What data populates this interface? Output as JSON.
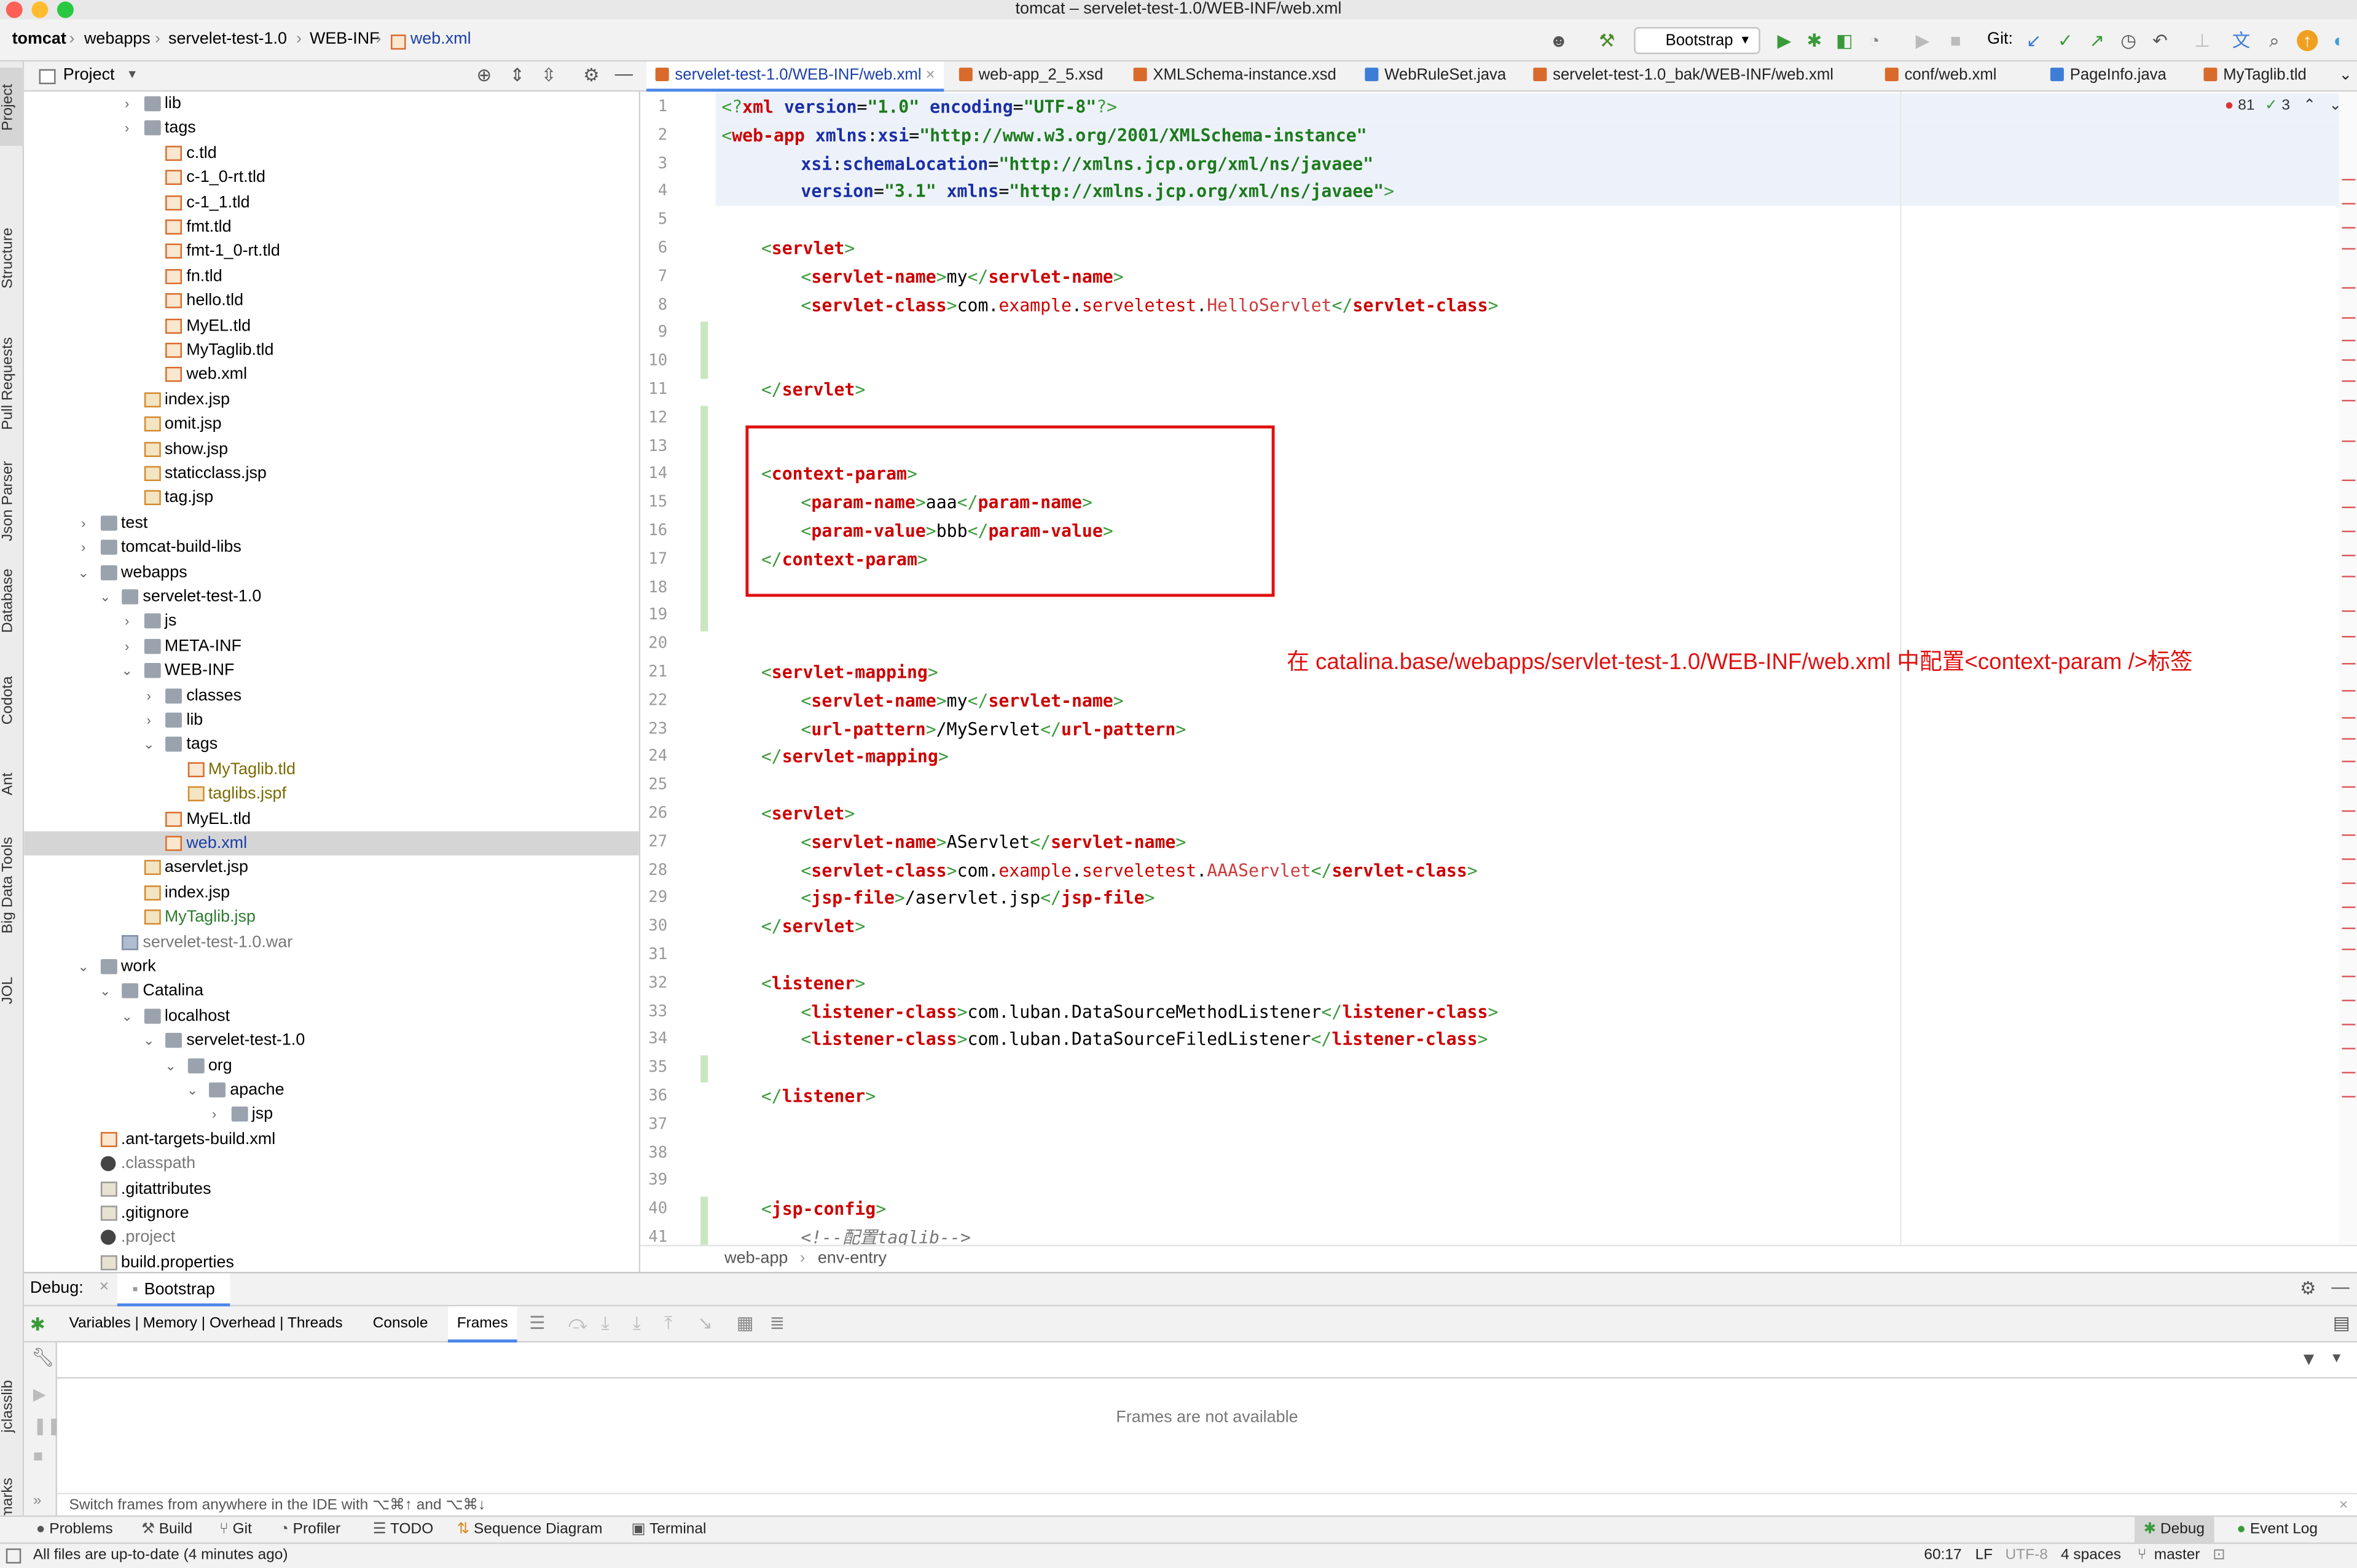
{
  "window_title": "tomcat – servelet-test-1.0/WEB-INF/web.xml",
  "navbar": {
    "crumbs": [
      "tomcat",
      "webapps",
      "servelet-test-1.0",
      "WEB-INF",
      "web.xml"
    ],
    "run_config": "Bootstrap",
    "git_label": "Git:"
  },
  "left_stripe": [
    "Project",
    "Structure",
    "Pull Requests",
    "Json Parser",
    "Database",
    "Codota",
    "Ant",
    "Big Data Tools",
    "JOL",
    "jclasslib",
    "Bookmarks"
  ],
  "project_panel": {
    "title": "Project",
    "tree": [
      {
        "label": "lib",
        "depth": 3,
        "arrow": "right",
        "icon": "folder"
      },
      {
        "label": "tags",
        "depth": 3,
        "arrow": "right",
        "icon": "folder"
      },
      {
        "label": "c.tld",
        "depth": 4,
        "arrow": "",
        "icon": "xml"
      },
      {
        "label": "c-1_0-rt.tld",
        "depth": 4,
        "arrow": "",
        "icon": "xml"
      },
      {
        "label": "c-1_1.tld",
        "depth": 4,
        "arrow": "",
        "icon": "xml"
      },
      {
        "label": "fmt.tld",
        "depth": 4,
        "arrow": "",
        "icon": "xml"
      },
      {
        "label": "fmt-1_0-rt.tld",
        "depth": 4,
        "arrow": "",
        "icon": "xml"
      },
      {
        "label": "fn.tld",
        "depth": 4,
        "arrow": "",
        "icon": "xml"
      },
      {
        "label": "hello.tld",
        "depth": 4,
        "arrow": "",
        "icon": "xml"
      },
      {
        "label": "MyEL.tld",
        "depth": 4,
        "arrow": "",
        "icon": "xml"
      },
      {
        "label": "MyTaglib.tld",
        "depth": 4,
        "arrow": "",
        "icon": "xml"
      },
      {
        "label": "web.xml",
        "depth": 4,
        "arrow": "",
        "icon": "xml"
      },
      {
        "label": "index.jsp",
        "depth": 3,
        "arrow": "",
        "icon": "jsp"
      },
      {
        "label": "omit.jsp",
        "depth": 3,
        "arrow": "",
        "icon": "jsp"
      },
      {
        "label": "show.jsp",
        "depth": 3,
        "arrow": "",
        "icon": "jsp"
      },
      {
        "label": "staticclass.jsp",
        "depth": 3,
        "arrow": "",
        "icon": "jsp"
      },
      {
        "label": "tag.jsp",
        "depth": 3,
        "arrow": "",
        "icon": "jsp"
      },
      {
        "label": "test",
        "depth": 1,
        "arrow": "right",
        "icon": "folder"
      },
      {
        "label": "tomcat-build-libs",
        "depth": 1,
        "arrow": "right",
        "icon": "folder"
      },
      {
        "label": "webapps",
        "depth": 1,
        "arrow": "down",
        "icon": "folder"
      },
      {
        "label": "servelet-test-1.0",
        "depth": 2,
        "arrow": "down",
        "icon": "folder"
      },
      {
        "label": "js",
        "depth": 3,
        "arrow": "right",
        "icon": "folder"
      },
      {
        "label": "META-INF",
        "depth": 3,
        "arrow": "right",
        "icon": "folder"
      },
      {
        "label": "WEB-INF",
        "depth": 3,
        "arrow": "down",
        "icon": "folder"
      },
      {
        "label": "classes",
        "depth": 4,
        "arrow": "right",
        "icon": "folder"
      },
      {
        "label": "lib",
        "depth": 4,
        "arrow": "right",
        "icon": "folder"
      },
      {
        "label": "tags",
        "depth": 4,
        "arrow": "down",
        "icon": "folder"
      },
      {
        "label": "MyTaglib.tld",
        "depth": 5,
        "arrow": "",
        "icon": "xml",
        "color": "#7a6a00"
      },
      {
        "label": "taglibs.jspf",
        "depth": 5,
        "arrow": "",
        "icon": "jsp",
        "color": "#7a6a00"
      },
      {
        "label": "MyEL.tld",
        "depth": 4,
        "arrow": "",
        "icon": "xml"
      },
      {
        "label": "web.xml",
        "depth": 4,
        "arrow": "",
        "icon": "xml",
        "selected": true,
        "color": "#1a3fa8"
      },
      {
        "label": "aservlet.jsp",
        "depth": 3,
        "arrow": "",
        "icon": "jsp"
      },
      {
        "label": "index.jsp",
        "depth": 3,
        "arrow": "",
        "icon": "jsp"
      },
      {
        "label": "MyTaglib.jsp",
        "depth": 3,
        "arrow": "",
        "icon": "jsp",
        "color": "#2f7a2f"
      },
      {
        "label": "servelet-test-1.0.war",
        "depth": 2,
        "arrow": "",
        "icon": "war",
        "color": "#777"
      },
      {
        "label": "work",
        "depth": 1,
        "arrow": "down",
        "icon": "folder"
      },
      {
        "label": "Catalina",
        "depth": 2,
        "arrow": "down",
        "icon": "folder"
      },
      {
        "label": "localhost",
        "depth": 3,
        "arrow": "down",
        "icon": "folder"
      },
      {
        "label": "servelet-test-1.0",
        "depth": 4,
        "arrow": "down",
        "icon": "folder"
      },
      {
        "label": "org",
        "depth": 5,
        "arrow": "down",
        "icon": "folder"
      },
      {
        "label": "apache",
        "depth": 6,
        "arrow": "down",
        "icon": "folder"
      },
      {
        "label": "jsp",
        "depth": 7,
        "arrow": "right",
        "icon": "folder"
      },
      {
        "label": ".ant-targets-build.xml",
        "depth": 1,
        "arrow": "",
        "icon": "xml"
      },
      {
        "label": ".classpath",
        "depth": 1,
        "arrow": "",
        "icon": "dot",
        "color": "#777"
      },
      {
        "label": ".gitattributes",
        "depth": 1,
        "arrow": "",
        "icon": "prop"
      },
      {
        "label": ".gitignore",
        "depth": 1,
        "arrow": "",
        "icon": "prop"
      },
      {
        "label": ".project",
        "depth": 1,
        "arrow": "",
        "icon": "dot",
        "color": "#777"
      },
      {
        "label": "build.properties",
        "depth": 1,
        "arrow": "",
        "icon": "prop"
      }
    ]
  },
  "editor_tabs": [
    {
      "label": "servelet-test-1.0/WEB-INF/web.xml",
      "active": true,
      "icon": "#d86a2b"
    },
    {
      "label": "web-app_2_5.xsd",
      "active": false,
      "icon": "#d86a2b"
    },
    {
      "label": "XMLSchema-instance.xsd",
      "active": false,
      "icon": "#d86a2b"
    },
    {
      "label": "WebRuleSet.java",
      "active": false,
      "icon": "#3d7dd8"
    },
    {
      "label": "servelet-test-1.0_bak/WEB-INF/web.xml",
      "active": false,
      "icon": "#d86a2b"
    },
    {
      "label": "conf/web.xml",
      "active": false,
      "icon": "#d86a2b"
    },
    {
      "label": "PageInfo.java",
      "active": false,
      "icon": "#3d7dd8"
    },
    {
      "label": "MyTaglib.tld",
      "active": false,
      "icon": "#d86a2b"
    }
  ],
  "inspection": {
    "errors": "81",
    "checks": "3"
  },
  "code_lines": [
    {
      "n": "1",
      "hl": true,
      "ind": 0,
      "t": [
        [
          "br",
          "<?"
        ],
        [
          "tg",
          "xml "
        ],
        [
          "at",
          "version"
        ],
        [
          "tx",
          "="
        ],
        [
          "vl",
          "\"1.0\" "
        ],
        [
          "at",
          "encoding"
        ],
        [
          "tx",
          "="
        ],
        [
          "vl",
          "\"UTF-8\""
        ],
        [
          "br",
          "?>"
        ]
      ]
    },
    {
      "n": "2",
      "hl": true,
      "ind": 0,
      "t": [
        [
          "br",
          "<"
        ],
        [
          "tg",
          "web-app "
        ],
        [
          "at",
          "xmlns"
        ],
        [
          "tx",
          ":"
        ],
        [
          "at",
          "xsi"
        ],
        [
          "tx",
          "="
        ],
        [
          "vl",
          "\"http://www.w3.org/2001/XMLSchema-instance\""
        ]
      ]
    },
    {
      "n": "3",
      "hl": true,
      "ind": 8,
      "t": [
        [
          "at",
          "xsi"
        ],
        [
          "tx",
          ":"
        ],
        [
          "at",
          "schemaLocation"
        ],
        [
          "tx",
          "="
        ],
        [
          "vl",
          "\"http://xmlns.jcp.org/xml/ns/javaee\""
        ]
      ]
    },
    {
      "n": "4",
      "hl": true,
      "ind": 8,
      "t": [
        [
          "at",
          "version"
        ],
        [
          "tx",
          "="
        ],
        [
          "vl",
          "\"3.1\" "
        ],
        [
          "at",
          "xmlns"
        ],
        [
          "tx",
          "="
        ],
        [
          "vl",
          "\"http://xmlns.jcp.org/xml/ns/javaee\""
        ],
        [
          "br",
          ">"
        ]
      ]
    },
    {
      "n": "5",
      "ind": 0,
      "t": []
    },
    {
      "n": "6",
      "ind": 4,
      "t": [
        [
          "br",
          "<"
        ],
        [
          "tg",
          "servlet"
        ],
        [
          "br",
          ">"
        ]
      ]
    },
    {
      "n": "7",
      "ind": 8,
      "t": [
        [
          "br",
          "<"
        ],
        [
          "tg",
          "servlet-name"
        ],
        [
          "br",
          ">"
        ],
        [
          "tx",
          "my"
        ],
        [
          "br",
          "</"
        ],
        [
          "tg",
          "servlet-name"
        ],
        [
          "br",
          ">"
        ]
      ]
    },
    {
      "n": "8",
      "ind": 8,
      "t": [
        [
          "br",
          "<"
        ],
        [
          "tg",
          "servlet-class"
        ],
        [
          "br",
          ">"
        ],
        [
          "tx",
          "com."
        ],
        [
          "pk",
          "example"
        ],
        [
          "tx",
          "."
        ],
        [
          "pk",
          "serveletest"
        ],
        [
          "tx",
          "."
        ],
        [
          "cs",
          "HelloServlet"
        ],
        [
          "br",
          "</"
        ],
        [
          "tg",
          "servlet-class"
        ],
        [
          "br",
          ">"
        ]
      ]
    },
    {
      "n": "9",
      "ind": 0,
      "t": []
    },
    {
      "n": "10",
      "ind": 0,
      "t": []
    },
    {
      "n": "11",
      "ind": 4,
      "t": [
        [
          "br",
          "</"
        ],
        [
          "tg",
          "servlet"
        ],
        [
          "br",
          ">"
        ]
      ]
    },
    {
      "n": "12",
      "ind": 0,
      "t": []
    },
    {
      "n": "13",
      "ind": 0,
      "t": []
    },
    {
      "n": "14",
      "ind": 4,
      "t": [
        [
          "br",
          "<"
        ],
        [
          "tg",
          "context-param"
        ],
        [
          "br",
          ">"
        ]
      ]
    },
    {
      "n": "15",
      "ind": 8,
      "t": [
        [
          "br",
          "<"
        ],
        [
          "tg",
          "param-name"
        ],
        [
          "br",
          ">"
        ],
        [
          "tx",
          "aaa"
        ],
        [
          "br",
          "</"
        ],
        [
          "tg",
          "param-name"
        ],
        [
          "br",
          ">"
        ]
      ]
    },
    {
      "n": "16",
      "ind": 8,
      "t": [
        [
          "br",
          "<"
        ],
        [
          "tg",
          "param-value"
        ],
        [
          "br",
          ">"
        ],
        [
          "tx",
          "bbb"
        ],
        [
          "br",
          "</"
        ],
        [
          "tg",
          "param-value"
        ],
        [
          "br",
          ">"
        ]
      ]
    },
    {
      "n": "17",
      "ind": 4,
      "t": [
        [
          "br",
          "</"
        ],
        [
          "tg",
          "context-param"
        ],
        [
          "br",
          ">"
        ]
      ]
    },
    {
      "n": "18",
      "ind": 0,
      "t": []
    },
    {
      "n": "19",
      "ind": 0,
      "t": []
    },
    {
      "n": "20",
      "ind": 0,
      "t": []
    },
    {
      "n": "21",
      "ind": 4,
      "t": [
        [
          "br",
          "<"
        ],
        [
          "tg",
          "servlet-mapping"
        ],
        [
          "br",
          ">"
        ]
      ]
    },
    {
      "n": "22",
      "ind": 8,
      "t": [
        [
          "br",
          "<"
        ],
        [
          "tg",
          "servlet-name"
        ],
        [
          "br",
          ">"
        ],
        [
          "tx",
          "my"
        ],
        [
          "br",
          "</"
        ],
        [
          "tg",
          "servlet-name"
        ],
        [
          "br",
          ">"
        ]
      ]
    },
    {
      "n": "23",
      "ind": 8,
      "t": [
        [
          "br",
          "<"
        ],
        [
          "tg",
          "url-pattern"
        ],
        [
          "br",
          ">"
        ],
        [
          "tx",
          "/MyServlet"
        ],
        [
          "br",
          "</"
        ],
        [
          "tg",
          "url-pattern"
        ],
        [
          "br",
          ">"
        ]
      ]
    },
    {
      "n": "24",
      "ind": 4,
      "t": [
        [
          "br",
          "</"
        ],
        [
          "tg",
          "servlet-mapping"
        ],
        [
          "br",
          ">"
        ]
      ]
    },
    {
      "n": "25",
      "ind": 0,
      "t": []
    },
    {
      "n": "26",
      "ind": 4,
      "t": [
        [
          "br",
          "<"
        ],
        [
          "tg",
          "servlet"
        ],
        [
          "br",
          ">"
        ]
      ]
    },
    {
      "n": "27",
      "ind": 8,
      "t": [
        [
          "br",
          "<"
        ],
        [
          "tg",
          "servlet-name"
        ],
        [
          "br",
          ">"
        ],
        [
          "tx",
          "AServlet"
        ],
        [
          "br",
          "</"
        ],
        [
          "tg",
          "servlet-name"
        ],
        [
          "br",
          ">"
        ]
      ]
    },
    {
      "n": "28",
      "ind": 8,
      "t": [
        [
          "br",
          "<"
        ],
        [
          "tg",
          "servlet-class"
        ],
        [
          "br",
          ">"
        ],
        [
          "tx",
          "com."
        ],
        [
          "pk",
          "example"
        ],
        [
          "tx",
          "."
        ],
        [
          "pk",
          "serveletest"
        ],
        [
          "tx",
          "."
        ],
        [
          "cs",
          "AAAServlet"
        ],
        [
          "br",
          "</"
        ],
        [
          "tg",
          "servlet-class"
        ],
        [
          "br",
          ">"
        ]
      ]
    },
    {
      "n": "29",
      "ind": 8,
      "t": [
        [
          "br",
          "<"
        ],
        [
          "tg",
          "jsp-file"
        ],
        [
          "br",
          ">"
        ],
        [
          "tx",
          "/aservlet.jsp"
        ],
        [
          "br",
          "</"
        ],
        [
          "tg",
          "jsp-file"
        ],
        [
          "br",
          ">"
        ]
      ]
    },
    {
      "n": "30",
      "ind": 4,
      "t": [
        [
          "br",
          "</"
        ],
        [
          "tg",
          "servlet"
        ],
        [
          "br",
          ">"
        ]
      ]
    },
    {
      "n": "31",
      "ind": 0,
      "t": []
    },
    {
      "n": "32",
      "ind": 4,
      "t": [
        [
          "br",
          "<"
        ],
        [
          "tg",
          "listener"
        ],
        [
          "br",
          ">"
        ]
      ]
    },
    {
      "n": "33",
      "ind": 8,
      "t": [
        [
          "br",
          "<"
        ],
        [
          "tg",
          "listener-class"
        ],
        [
          "br",
          ">"
        ],
        [
          "tx",
          "com.luban.DataSourceMethodListener"
        ],
        [
          "br",
          "</"
        ],
        [
          "tg",
          "listener-class"
        ],
        [
          "br",
          ">"
        ]
      ]
    },
    {
      "n": "34",
      "ind": 8,
      "t": [
        [
          "br",
          "<"
        ],
        [
          "tg",
          "listener-class"
        ],
        [
          "br",
          ">"
        ],
        [
          "tx",
          "com.luban.DataSourceFiledListener"
        ],
        [
          "br",
          "</"
        ],
        [
          "tg",
          "listener-class"
        ],
        [
          "br",
          ">"
        ]
      ]
    },
    {
      "n": "35",
      "ind": 0,
      "t": []
    },
    {
      "n": "36",
      "ind": 4,
      "t": [
        [
          "br",
          "</"
        ],
        [
          "tg",
          "listener"
        ],
        [
          "br",
          ">"
        ]
      ]
    },
    {
      "n": "37",
      "ind": 0,
      "t": []
    },
    {
      "n": "38",
      "ind": 0,
      "t": []
    },
    {
      "n": "39",
      "ind": 0,
      "t": []
    },
    {
      "n": "40",
      "ind": 4,
      "t": [
        [
          "br",
          "<"
        ],
        [
          "tg",
          "jsp-config"
        ],
        [
          "br",
          ">"
        ]
      ]
    },
    {
      "n": "41",
      "ind": 8,
      "t": [
        [
          "cm",
          "<!--配置taglib-->"
        ]
      ]
    }
  ],
  "annotation_text": "在 catalina.base/webapps/servlet-test-1.0/WEB-INF/web.xml 中配置<context-param />标签",
  "editor_breadcrumb": [
    "web-app",
    "env-entry"
  ],
  "debug": {
    "label": "Debug:",
    "session": "Bootstrap",
    "tabs": [
      "Variables | Memory | Overhead | Threads",
      "Console",
      "Frames"
    ],
    "active_tab": "Frames",
    "empty_message": "Frames are not available",
    "hint": "Switch frames from anywhere in the IDE with ⌥⌘↑ and ⌥⌘↓"
  },
  "bottom_tools": [
    "Problems",
    "Build",
    "Git",
    "Profiler",
    "TODO",
    "Sequence Diagram",
    "Terminal"
  ],
  "bottom_right_tools": [
    "Debug",
    "Event Log"
  ],
  "status": {
    "message": "All files are up-to-date (4 minutes ago)",
    "position": "60:17",
    "line_sep": "LF",
    "encoding": "UTF-8",
    "indent": "4 spaces",
    "branch": "master"
  }
}
